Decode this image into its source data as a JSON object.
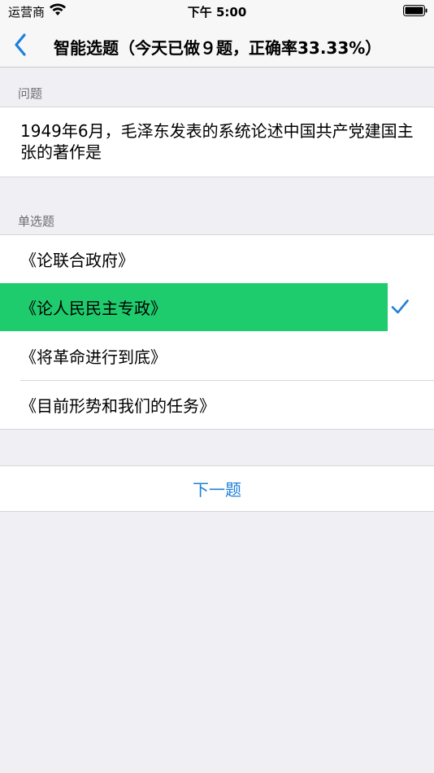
{
  "status_bar": {
    "carrier": "运营商",
    "time": "下午 5:00"
  },
  "nav": {
    "title": "智能选题（今天已做９题，正确率33.33%）",
    "accent": "#1f7fd9"
  },
  "question_section": {
    "header": "问题",
    "text": "1949年6月，毛泽东发表的系统论述中国共产党建国主张的著作是"
  },
  "options_section": {
    "header": "单选题",
    "options": [
      {
        "label": "《论联合政府》",
        "selected": false
      },
      {
        "label": "《论人民民主专政》",
        "selected": true
      },
      {
        "label": "《将革命进行到底》",
        "selected": false
      },
      {
        "label": "《目前形势和我们的任务》",
        "selected": false
      }
    ],
    "selected_color": "#1ecc6e"
  },
  "next_button": {
    "label": "下一题"
  }
}
